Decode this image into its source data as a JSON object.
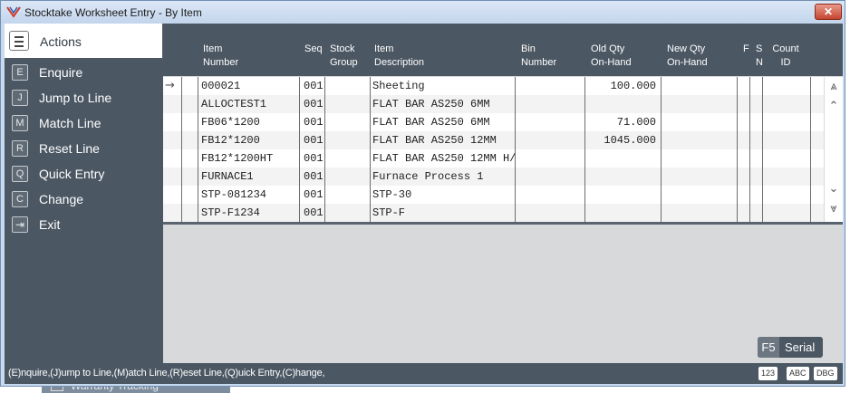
{
  "window": {
    "title": "Stocktake Worksheet Entry - By Item",
    "close_label": "✕"
  },
  "sidebar": {
    "header": "Actions",
    "items": [
      {
        "key": "E",
        "label": "Enquire"
      },
      {
        "key": "J",
        "label": "Jump to Line"
      },
      {
        "key": "M",
        "label": "Match Line"
      },
      {
        "key": "R",
        "label": "Reset Line"
      },
      {
        "key": "Q",
        "label": "Quick Entry"
      },
      {
        "key": "C",
        "label": "Change"
      },
      {
        "key": "⇥",
        "label": "Exit"
      }
    ]
  },
  "grid": {
    "headers": {
      "item_number": [
        "Item",
        "Number"
      ],
      "seq": [
        "",
        "Seq"
      ],
      "stock_group": [
        "Stock",
        "Group"
      ],
      "item_description": [
        "Item",
        "Description"
      ],
      "bin_number": [
        "Bin",
        "Number"
      ],
      "old_qty": [
        "Old Qty",
        "On-Hand"
      ],
      "new_qty": [
        "New Qty",
        "On-Hand"
      ],
      "f": [
        "F",
        ""
      ],
      "sn": [
        "S",
        "N"
      ],
      "count_id": [
        "Count",
        "ID"
      ]
    },
    "current_row_marker": "→",
    "rows": [
      {
        "item_number": "000021",
        "seq": "001",
        "stock_group": "",
        "description": "Sheeting",
        "bin": "",
        "old_qty": "100.000",
        "new_qty": ""
      },
      {
        "item_number": "ALLOCTEST1",
        "seq": "001",
        "stock_group": "",
        "description": "FLAT BAR AS250 6MM",
        "bin": "",
        "old_qty": "",
        "new_qty": ""
      },
      {
        "item_number": "FB06*1200",
        "seq": "001",
        "stock_group": "",
        "description": "FLAT BAR AS250 6MM",
        "bin": "",
        "old_qty": "71.000",
        "new_qty": ""
      },
      {
        "item_number": "FB12*1200",
        "seq": "001",
        "stock_group": "",
        "description": "FLAT BAR AS250 12MM",
        "bin": "",
        "old_qty": "1045.000",
        "new_qty": ""
      },
      {
        "item_number": "FB12*1200HT",
        "seq": "001",
        "stock_group": "",
        "description": "FLAT BAR AS250 12MM H/",
        "bin": "",
        "old_qty": "",
        "new_qty": ""
      },
      {
        "item_number": "FURNACE1",
        "seq": "001",
        "stock_group": "",
        "description": "Furnace Process 1",
        "bin": "",
        "old_qty": "",
        "new_qty": ""
      },
      {
        "item_number": "STP-081234",
        "seq": "001",
        "stock_group": "",
        "description": "STP-30",
        "bin": "",
        "old_qty": "",
        "new_qty": ""
      },
      {
        "item_number": "STP-F1234",
        "seq": "001",
        "stock_group": "",
        "description": "STP-F",
        "bin": "",
        "old_qty": "",
        "new_qty": ""
      }
    ],
    "scroll_icons": {
      "top": "⩓",
      "up": "⌃",
      "down": "⌄",
      "bottom": "⩔"
    }
  },
  "f5_button": {
    "key": "F5",
    "label": "Serial"
  },
  "status": {
    "text": "(E)nquire,(J)ump to Line,(M)atch Line,(R)eset Line,(Q)uick Entry,(C)hange,",
    "indicators": [
      "123",
      "ABC",
      "DBG"
    ]
  },
  "background_window": {
    "text": "Warranty Tracking"
  },
  "colors": {
    "panel": "#4b5763",
    "title_bar": "#c9daf0",
    "close_button": "#c5442f",
    "grid_bg": "#d7d9db"
  }
}
